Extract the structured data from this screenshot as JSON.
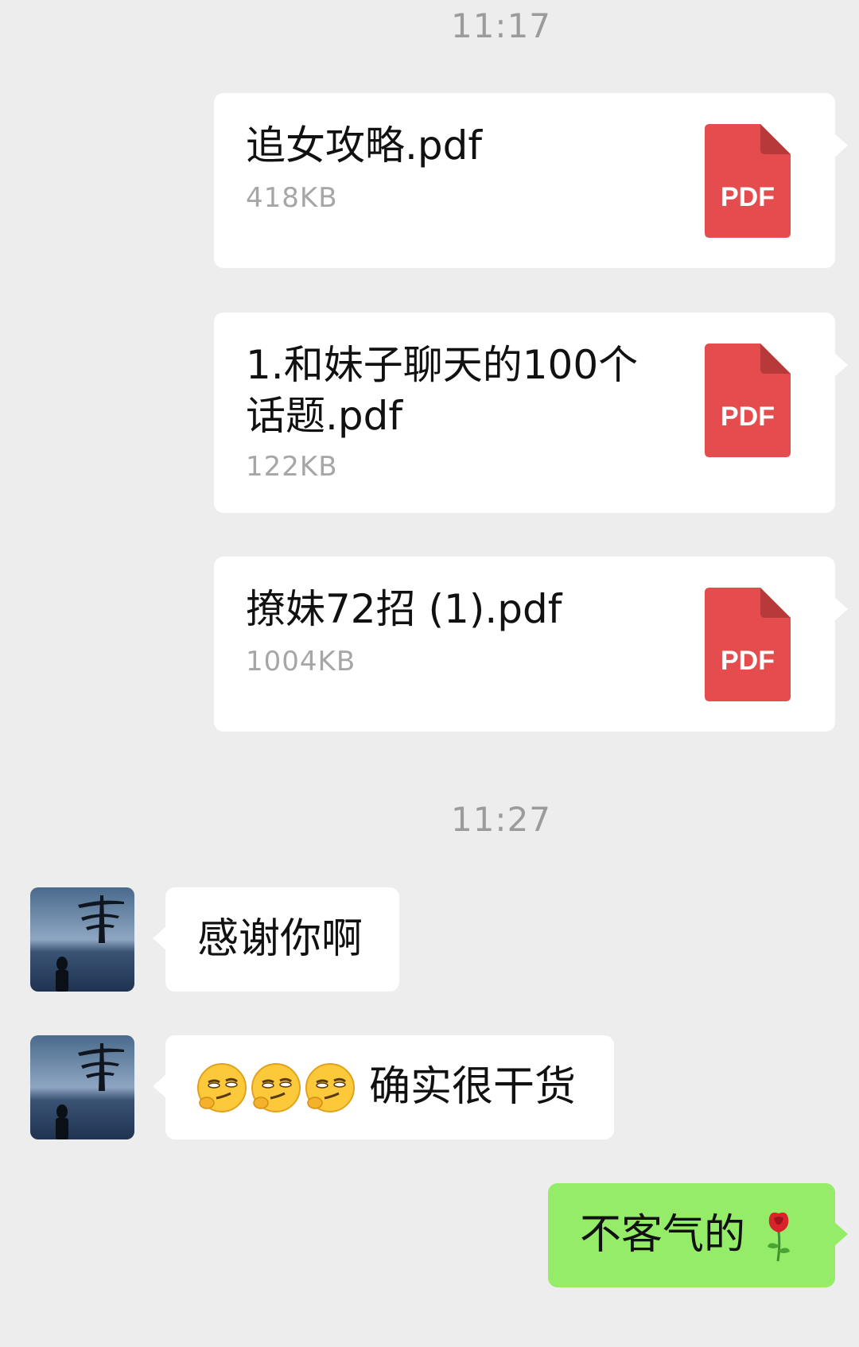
{
  "timestamps": [
    "11:17",
    "11:27"
  ],
  "files": [
    {
      "name": "追女攻略.pdf",
      "size": "418KB",
      "type_label": "PDF"
    },
    {
      "name": "1.和妹子聊天的100个话题.pdf",
      "size": "122KB",
      "type_label": "PDF"
    },
    {
      "name": "撩妹72招 (1).pdf",
      "size": "1004KB",
      "type_label": "PDF"
    }
  ],
  "messages": [
    {
      "text": "感谢你啊",
      "avatar_icon": "avatar-tree-silhouette"
    },
    {
      "text": "确实很干货",
      "emojis": [
        "smirk-emoji",
        "smirk-emoji",
        "smirk-emoji"
      ],
      "avatar_icon": "avatar-tree-silhouette"
    }
  ],
  "reply": {
    "text": "不客气的",
    "emoji": "rose-emoji"
  },
  "colors": {
    "background": "#ededed",
    "incoming_bubble": "#ffffff",
    "outgoing_bubble": "#95ec69",
    "pdf_red": "#e44c4d",
    "timestamp": "#9b9b9b"
  }
}
